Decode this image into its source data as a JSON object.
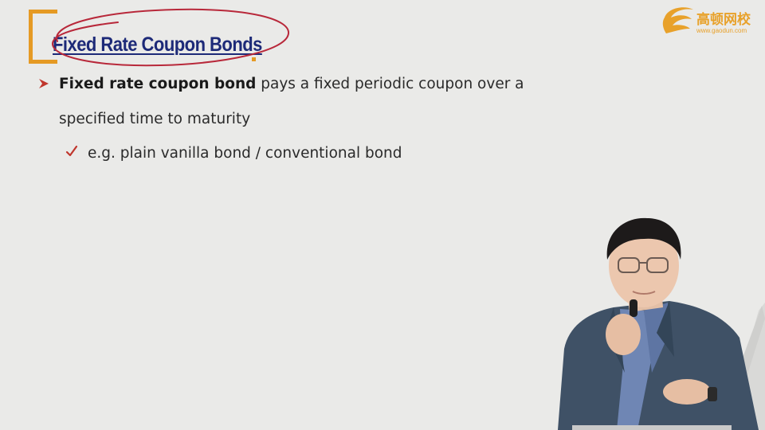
{
  "slide": {
    "title": "Fixed Rate Coupon Bonds",
    "logo": {
      "name": "高顿网校",
      "url": "www.gaodun.com"
    },
    "bullet": {
      "bold_text": "Fixed rate coupon bond",
      "rest_text": " pays a fixed periodic coupon over a specified time to maturity"
    },
    "sub_bullet": {
      "text": "e.g. plain vanilla bond / conventional bond"
    }
  },
  "colors": {
    "title": "#1d2a78",
    "accent_orange": "#e59a24",
    "annotation_red": "#b8283a",
    "bullet_arrow": "#c0362c",
    "check": "#c0362c",
    "background": "#eaeae8"
  },
  "icons": {
    "bullet": "arrow-bullet-icon",
    "sub_bullet": "checkmark-icon",
    "logo": "gaodun-logo-icon"
  }
}
